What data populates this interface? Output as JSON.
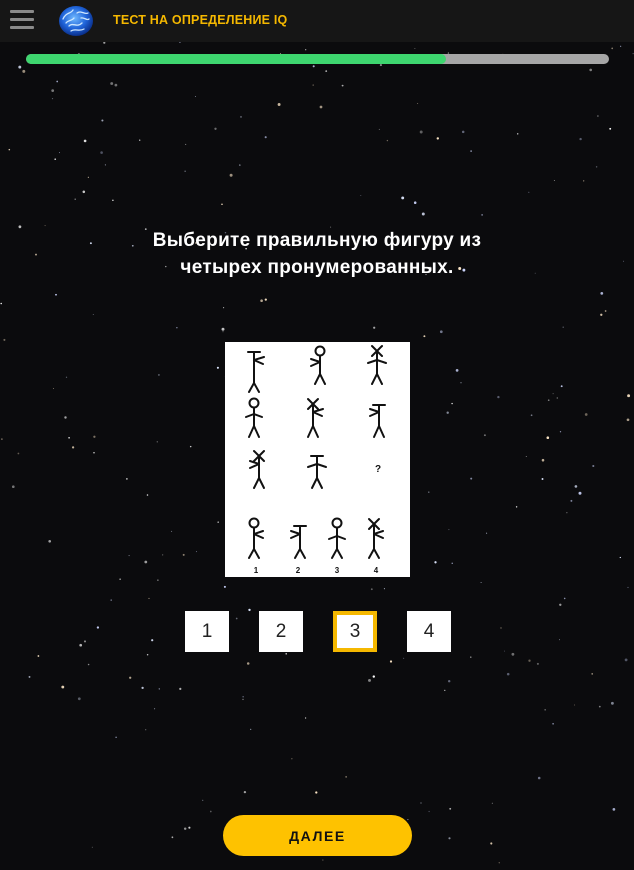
{
  "header": {
    "title": "ТЕСТ НА ОПРЕДЕЛЕНИЕ IQ",
    "menu_icon": "hamburger-menu-icon",
    "logo_icon": "brain-logo-icon"
  },
  "progress": {
    "fraction": 0.72
  },
  "question": {
    "text": "Выберите правильную фигуру из четырех пронумерованных."
  },
  "puzzle": {
    "question_mark": "?",
    "option_labels": [
      "1",
      "2",
      "3",
      "4"
    ]
  },
  "answers": {
    "options": [
      "1",
      "2",
      "3",
      "4"
    ],
    "selected": "3"
  },
  "footer": {
    "next_label": "ДАЛЕЕ"
  },
  "colors": {
    "accent": "#fec200",
    "title": "#f5b800",
    "progress": "#3ed66f",
    "progress_track": "#a6a6a6"
  }
}
